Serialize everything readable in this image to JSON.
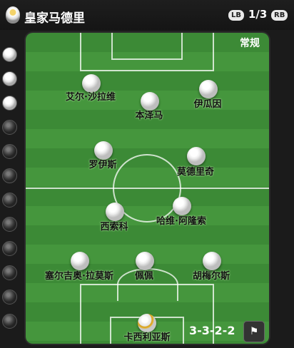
{
  "header": {
    "team_name": "皇家马德里",
    "lb_label": "LB",
    "page_indicator": "1/3",
    "rb_label": "RB"
  },
  "pitch": {
    "tactic_style": "常规",
    "formation": "3-3-2-2"
  },
  "players": [
    {
      "name": "艾尔·沙拉维",
      "role": "outfield"
    },
    {
      "name": "本泽马",
      "role": "outfield"
    },
    {
      "name": "伊瓜因",
      "role": "outfield"
    },
    {
      "name": "罗伊斯",
      "role": "outfield"
    },
    {
      "name": "莫德里奇",
      "role": "outfield"
    },
    {
      "name": "西索科",
      "role": "outfield"
    },
    {
      "name": "哈维·阿隆索",
      "role": "outfield"
    },
    {
      "name": "塞尔吉奥·拉莫斯",
      "role": "outfield"
    },
    {
      "name": "佩佩",
      "role": "outfield"
    },
    {
      "name": "胡梅尔斯",
      "role": "outfield"
    },
    {
      "name": "卡西利亚斯",
      "role": "goalkeeper"
    }
  ],
  "side_slots": [
    "on",
    "on",
    "on",
    "off",
    "off",
    "off",
    "off",
    "off",
    "off",
    "off",
    "off",
    "off"
  ],
  "captain_icon": "captain-armband-icon"
}
